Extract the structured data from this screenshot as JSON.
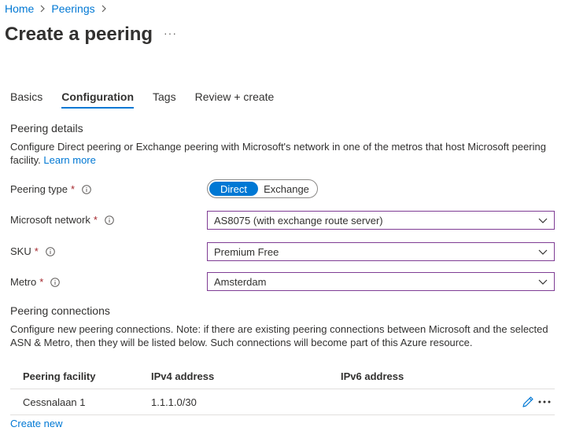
{
  "breadcrumb": {
    "home": "Home",
    "peerings": "Peerings"
  },
  "page": {
    "title": "Create a peering",
    "more": "···"
  },
  "tabs": [
    {
      "label": "Basics"
    },
    {
      "label": "Configuration"
    },
    {
      "label": "Tags"
    },
    {
      "label": "Review + create"
    }
  ],
  "peering_details": {
    "heading": "Peering details",
    "description": "Configure Direct peering or Exchange peering with Microsoft's network in one of the metros that host Microsoft peering facility.",
    "learn_more": "Learn more"
  },
  "form": {
    "peering_type": {
      "label": "Peering type",
      "required": "*",
      "options": [
        "Direct",
        "Exchange"
      ],
      "selected": "Direct"
    },
    "microsoft_network": {
      "label": "Microsoft network",
      "required": "*",
      "value": "AS8075 (with exchange route server)"
    },
    "sku": {
      "label": "SKU",
      "required": "*",
      "value": "Premium Free"
    },
    "metro": {
      "label": "Metro",
      "required": "*",
      "value": "Amsterdam"
    }
  },
  "peering_connections": {
    "heading": "Peering connections",
    "description": "Configure new peering connections. Note: if there are existing peering connections between Microsoft and the selected ASN & Metro, then they will be listed below. Such connections will become part of this Azure resource.",
    "columns": [
      "Peering facility",
      "IPv4 address",
      "IPv6 address"
    ],
    "rows": [
      {
        "facility": "Cessnalaan 1",
        "ipv4": "1.1.1.0/30",
        "ipv6": ""
      }
    ],
    "create_new": "Create new"
  },
  "colors": {
    "accent": "#0078d4",
    "required": "#a4262c",
    "select_border": "#7f3c94"
  }
}
